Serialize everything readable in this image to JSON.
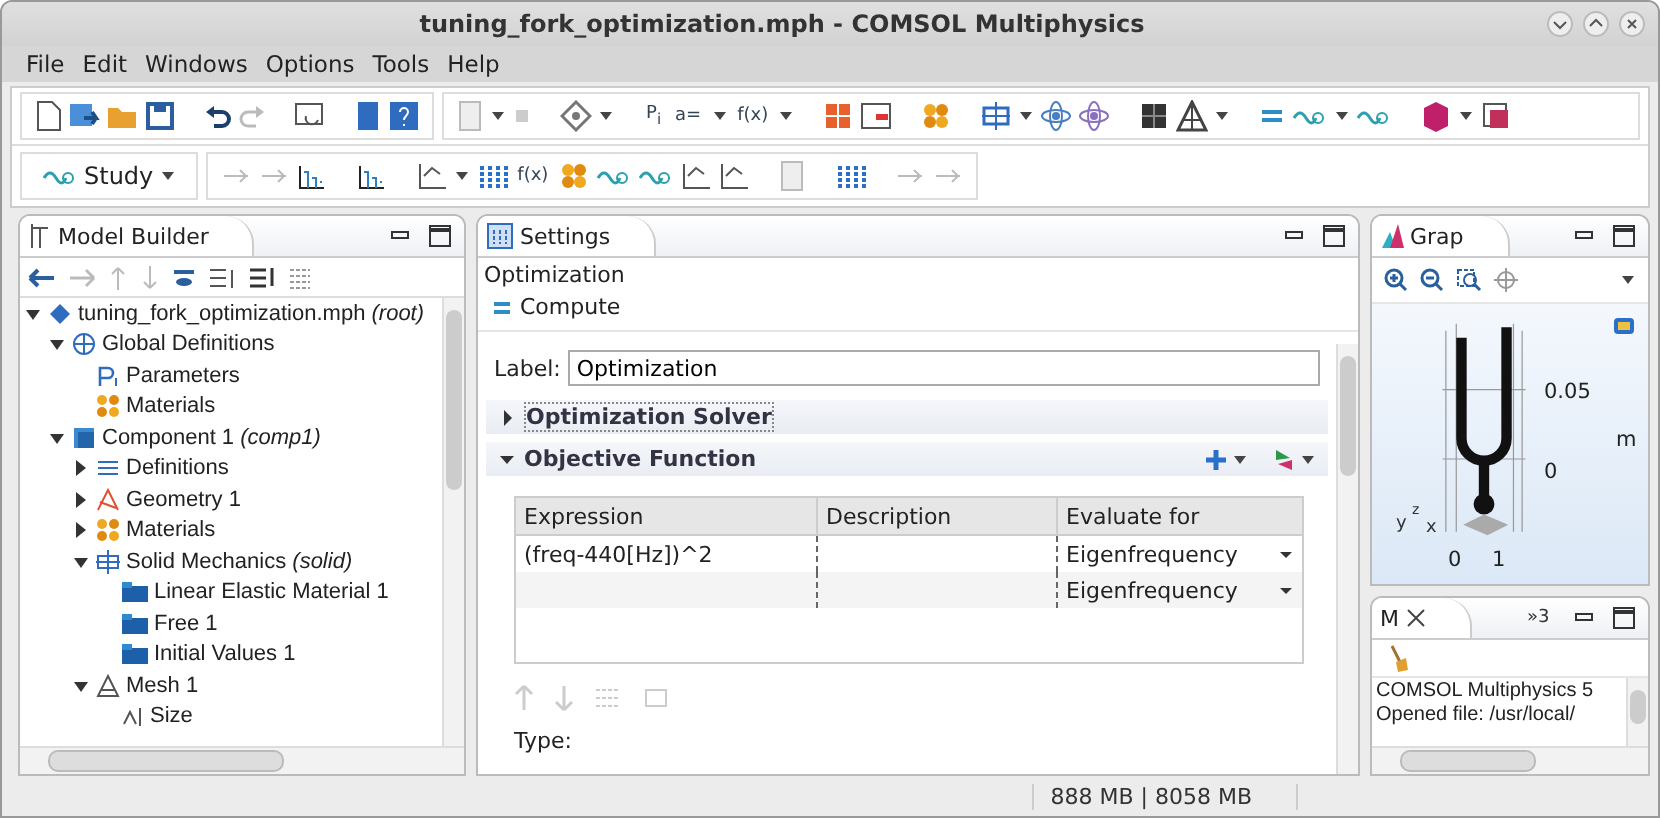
{
  "window": {
    "title": "tuning_fork_optimization.mph - COMSOL Multiphysics"
  },
  "menu": [
    "File",
    "Edit",
    "Windows",
    "Options",
    "Tools",
    "Help"
  ],
  "main_toolbar": {
    "glyphs": [
      "P$_{i}$",
      "a=",
      "f(x)"
    ]
  },
  "study_toolbar": {
    "study_button": "Study",
    "glyphs": [
      "f(x)"
    ]
  },
  "model_builder": {
    "tab": "Model Builder",
    "tree": [
      {
        "label": "tuning_fork_optimization.mph *(root)*",
        "kind": "file",
        "expanded": true,
        "children": [
          {
            "label": "Global Definitions",
            "kind": "globe",
            "expanded": true,
            "children": [
              {
                "label": "Parameters",
                "kind": "param"
              },
              {
                "label": "Materials",
                "kind": "material"
              }
            ]
          },
          {
            "label": "Component 1 *(comp1)*",
            "kind": "component",
            "expanded": true,
            "children": [
              {
                "label": "Definitions",
                "kind": "definitions",
                "expanded": false
              },
              {
                "label": "Geometry 1",
                "kind": "geometry",
                "expanded": false
              },
              {
                "label": "Materials",
                "kind": "material",
                "expanded": false
              },
              {
                "label": "Solid Mechanics *(solid)*",
                "kind": "physics",
                "expanded": true,
                "children": [
                  {
                    "label": "Linear Elastic Material 1",
                    "kind": "feature"
                  },
                  {
                    "label": "Free 1",
                    "kind": "feature"
                  },
                  {
                    "label": "Initial Values 1",
                    "kind": "feature"
                  }
                ]
              },
              {
                "label": "Mesh 1",
                "kind": "mesh",
                "expanded": true,
                "children": [
                  {
                    "label": "Size",
                    "kind": "size"
                  }
                ]
              }
            ]
          }
        ]
      }
    ]
  },
  "settings": {
    "tab": "Settings",
    "node_type": "Optimization",
    "compute_button": "Compute",
    "label_field": {
      "label": "Label:",
      "value": "Optimization"
    },
    "sections": [
      {
        "title": "Optimization Solver",
        "expanded": false
      },
      {
        "title": "Objective Function",
        "expanded": true
      }
    ],
    "table": {
      "columns": [
        "Expression",
        "Description",
        "Evaluate for"
      ],
      "rows": [
        {
          "expression": "(freq-440[Hz])^2",
          "evaluate_for": "Eigenfrequency"
        },
        {
          "evaluate_for": "Eigenfrequency"
        }
      ]
    },
    "next_field_label": "Type:"
  },
  "graphics": {
    "tab": "Grap",
    "axis_labels": [
      "0.05",
      "m",
      "0",
      "0",
      "1"
    ],
    "triad": [
      "y",
      "z",
      "x"
    ]
  },
  "messages": {
    "tabs": [
      "M",
      "»3"
    ],
    "lines": [
      "COMSOL Multiphysics 5",
      "Opened file: /usr/local/"
    ]
  },
  "status_bar": {
    "memory": "888 MB | 8058 MB"
  }
}
